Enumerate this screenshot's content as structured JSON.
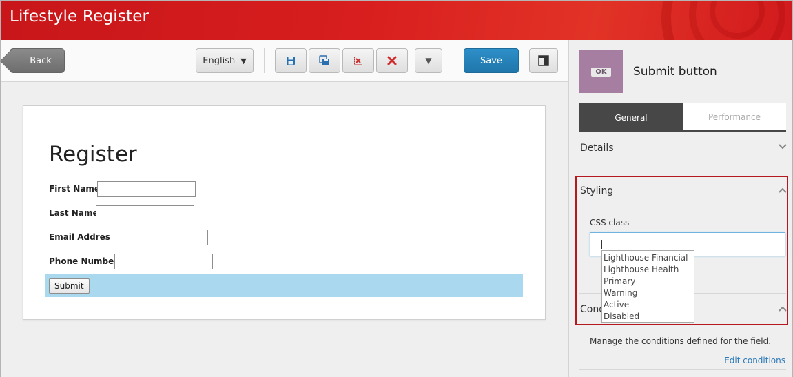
{
  "app": {
    "title": "Lifestyle Register"
  },
  "toolbar": {
    "back_label": "Back",
    "language": "English",
    "save_label": "Save"
  },
  "form": {
    "title": "Register",
    "fields": [
      {
        "label": "First Name"
      },
      {
        "label": "Last Name"
      },
      {
        "label": "Email Address"
      },
      {
        "label": "Phone Number"
      }
    ],
    "submit_label": "Submit"
  },
  "panel": {
    "thumb_badge": "OK",
    "item_title": "Submit button",
    "tabs": [
      {
        "label": "General",
        "active": true
      },
      {
        "label": "Performance",
        "active": false
      }
    ],
    "sections": {
      "details": "Details",
      "styling": "Styling",
      "conditions_prefix": "Cond"
    },
    "css_class_label": "CSS class",
    "css_class_value": "",
    "css_options": [
      "Lighthouse Financial",
      "Lighthouse Health",
      "Primary",
      "Warning",
      "Active",
      "Disabled"
    ],
    "conditions_text": "Manage the conditions defined for the field.",
    "edit_conditions_label": "Edit conditions"
  },
  "colors": {
    "header": "#d81e1e",
    "save_button": "#2583bb",
    "highlight": "#b3191e",
    "submit_row": "#aad8ee"
  }
}
